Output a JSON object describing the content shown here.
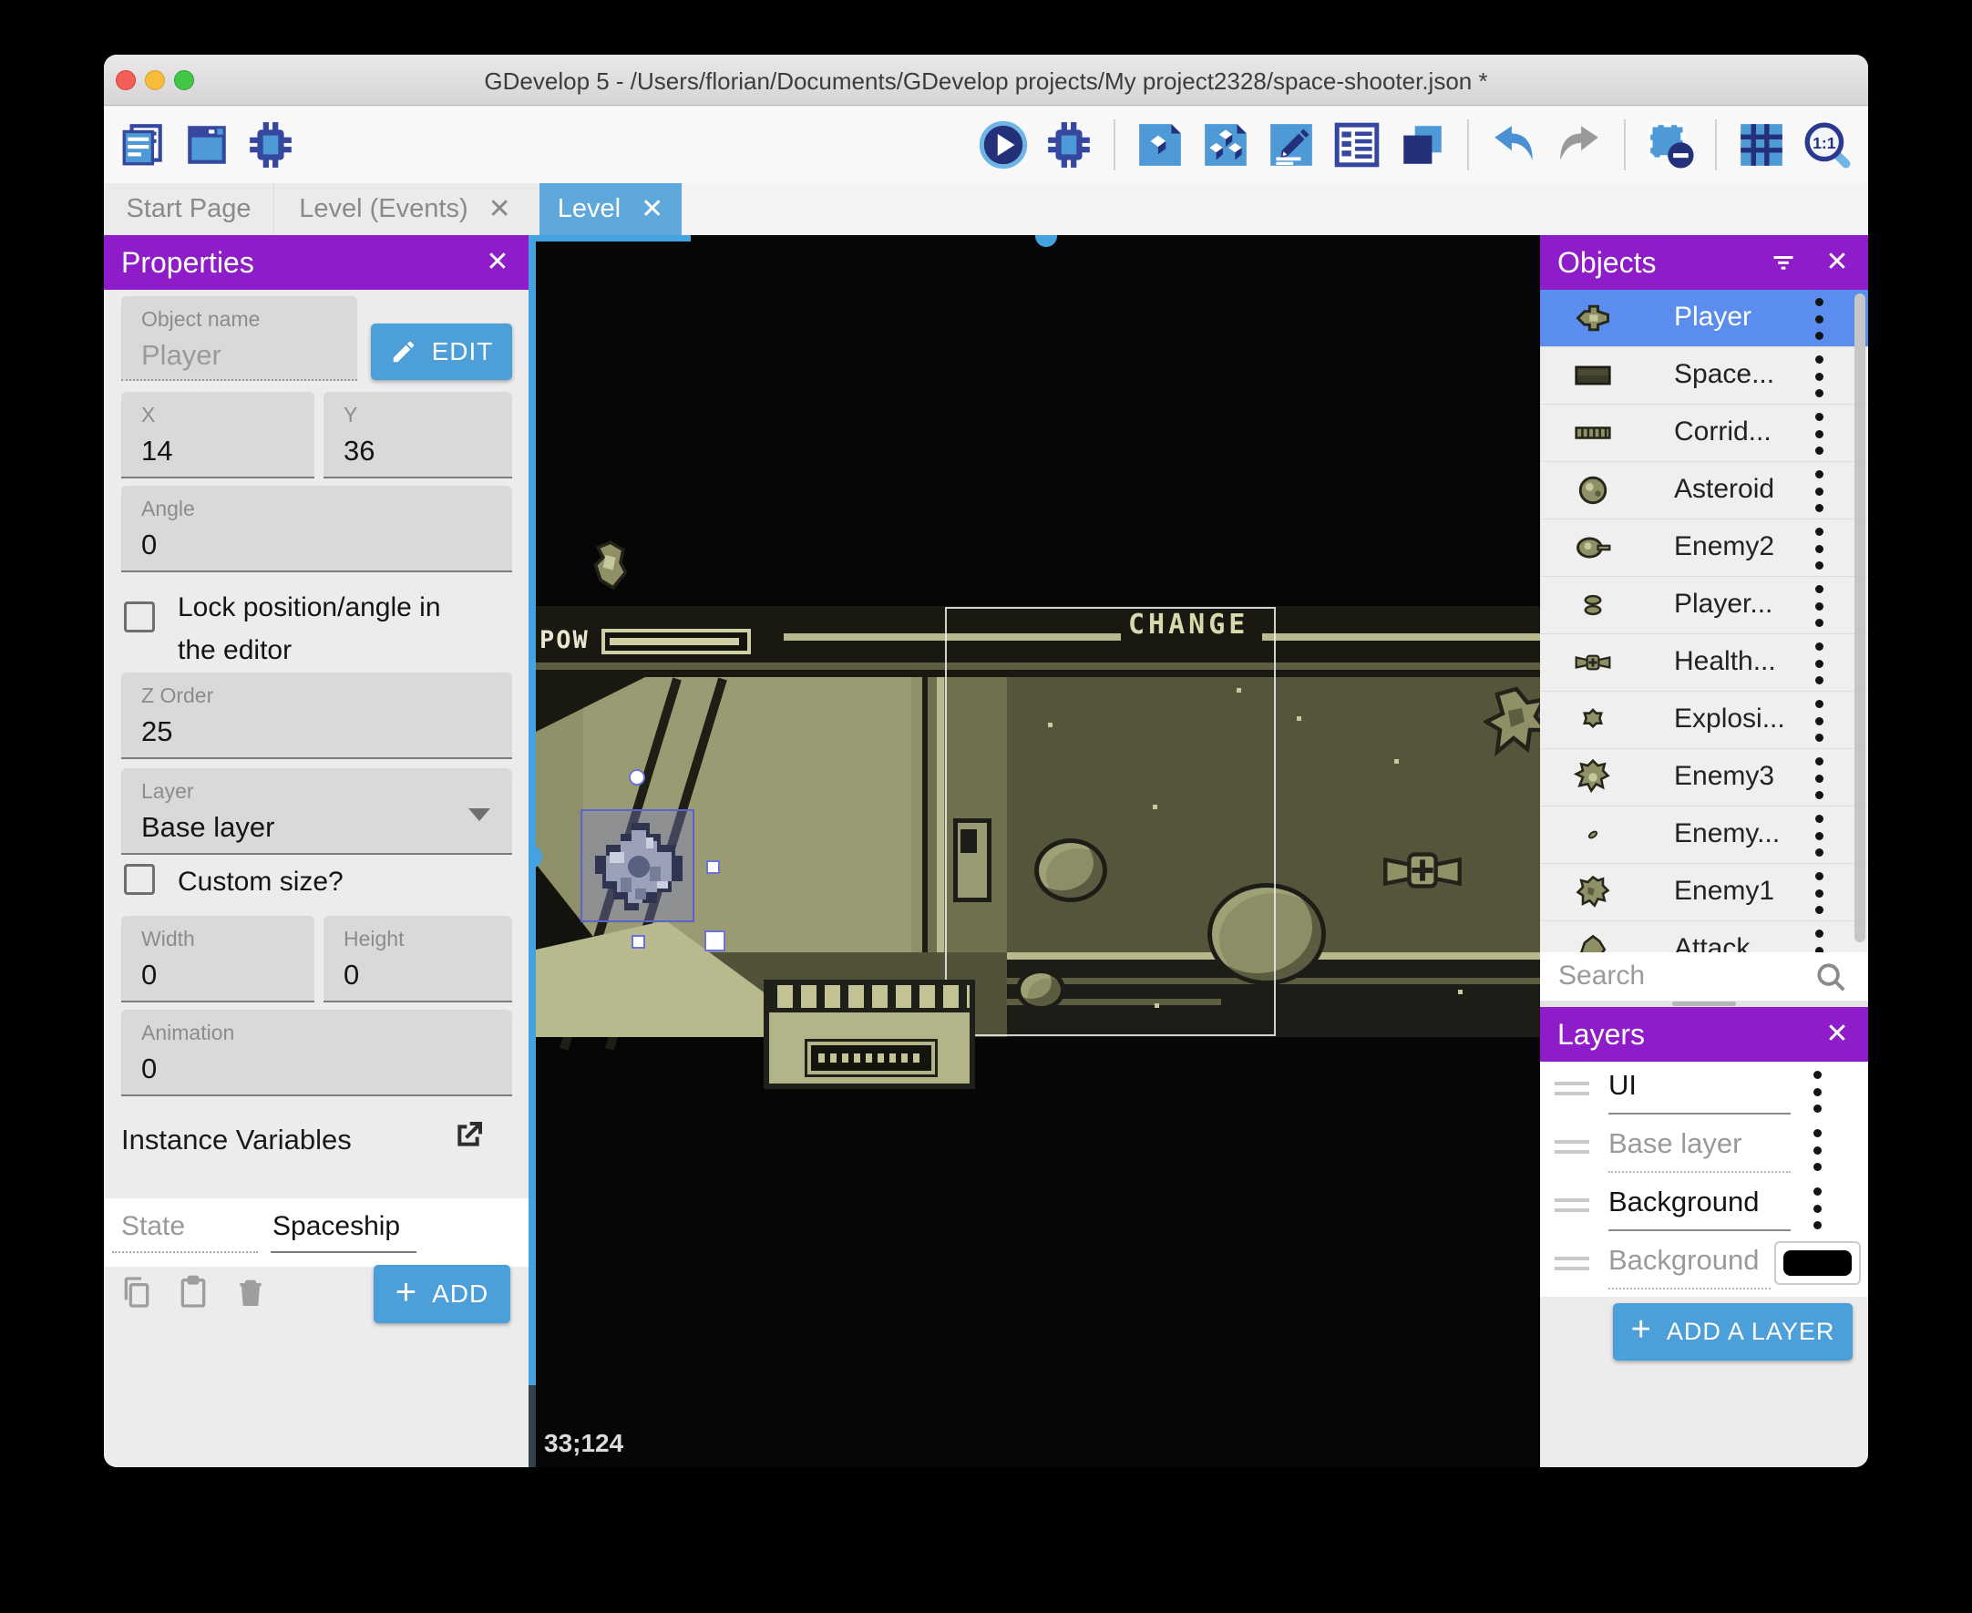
{
  "window": {
    "title": "GDevelop 5 - /Users/florian/Documents/GDevelop projects/My project2328/space-shooter.json *"
  },
  "toolbar": {
    "left": [
      "project-manager-icon",
      "windows-icon",
      "debugger-icon"
    ],
    "right": [
      "play-icon",
      "debug-icon",
      "separator",
      "object-icon",
      "objects-group-icon",
      "edit-icon",
      "instances-list-icon",
      "layers-stack-icon",
      "separator",
      "undo-icon",
      "redo-icon",
      "separator",
      "mask-icon",
      "separator",
      "grid-icon",
      "zoom-1-1-icon"
    ]
  },
  "tabs": [
    {
      "label": "Start Page",
      "active": false,
      "closable": false
    },
    {
      "label": "Level (Events)",
      "active": false,
      "closable": true
    },
    {
      "label": "Level",
      "active": true,
      "closable": true
    }
  ],
  "properties_panel": {
    "title": "Properties",
    "object_name": {
      "label": "Object name",
      "value": "Player"
    },
    "edit_button": "EDIT",
    "x": {
      "label": "X",
      "value": "14"
    },
    "y": {
      "label": "Y",
      "value": "36"
    },
    "angle": {
      "label": "Angle",
      "value": "0"
    },
    "lock_checkbox": {
      "label_line1": "Lock position/angle in",
      "label_line2": "the editor",
      "checked": false
    },
    "z_order": {
      "label": "Z Order",
      "value": "25"
    },
    "layer": {
      "label": "Layer",
      "value": "Base layer"
    },
    "custom_size_checkbox": {
      "label": "Custom size?",
      "checked": false
    },
    "width": {
      "label": "Width",
      "value": "0"
    },
    "height": {
      "label": "Height",
      "value": "0"
    },
    "animation": {
      "label": "Animation",
      "value": "0"
    },
    "instance_variables_label": "Instance Variables",
    "variables": [
      {
        "name": "State",
        "value": "Spaceship"
      }
    ],
    "add_button": "ADD"
  },
  "scene": {
    "hud": {
      "pow_label": "POW",
      "change_label": "CHANGE"
    },
    "cursor_coordinates": "33;124",
    "selected_instance": "Player"
  },
  "objects_panel": {
    "title": "Objects",
    "search_placeholder": "Search",
    "items": [
      {
        "label": "Player",
        "icon": "player-ship-icon",
        "selected": true
      },
      {
        "label": "Space...",
        "icon": "space-background-icon",
        "selected": false
      },
      {
        "label": "Corrid...",
        "icon": "corridor-icon",
        "selected": false
      },
      {
        "label": "Asteroid",
        "icon": "asteroid-icon",
        "selected": false
      },
      {
        "label": "Enemy2",
        "icon": "enemy2-icon",
        "selected": false
      },
      {
        "label": "Player...",
        "icon": "player-bullet-icon",
        "selected": false
      },
      {
        "label": "Health...",
        "icon": "health-icon",
        "selected": false
      },
      {
        "label": "Explosi...",
        "icon": "explosion-icon",
        "selected": false
      },
      {
        "label": "Enemy3",
        "icon": "enemy3-icon",
        "selected": false
      },
      {
        "label": "Enemy...",
        "icon": "enemy-bullet-icon",
        "selected": false
      },
      {
        "label": "Enemy1",
        "icon": "enemy1-icon",
        "selected": false
      },
      {
        "label": "Attack...",
        "icon": "attack-icon",
        "selected": false
      }
    ]
  },
  "layers_panel": {
    "title": "Layers",
    "items": [
      {
        "label": "UI",
        "muted": false,
        "has_color_swatch": false
      },
      {
        "label": "Base layer",
        "muted": true,
        "has_color_swatch": false
      },
      {
        "label": "Background",
        "muted": false,
        "has_color_swatch": false
      },
      {
        "label": "Background",
        "muted": true,
        "has_color_swatch": true,
        "swatch_color": "#000000"
      }
    ],
    "add_layer_button": "ADD A LAYER"
  },
  "colors": {
    "accent_purple": "#8e1cc8",
    "accent_blue": "#4d9fd9",
    "tab_active_blue": "#5fa8dc",
    "selected_row_blue": "#5b8def",
    "canvas_handle_blue": "#45a2e0"
  }
}
